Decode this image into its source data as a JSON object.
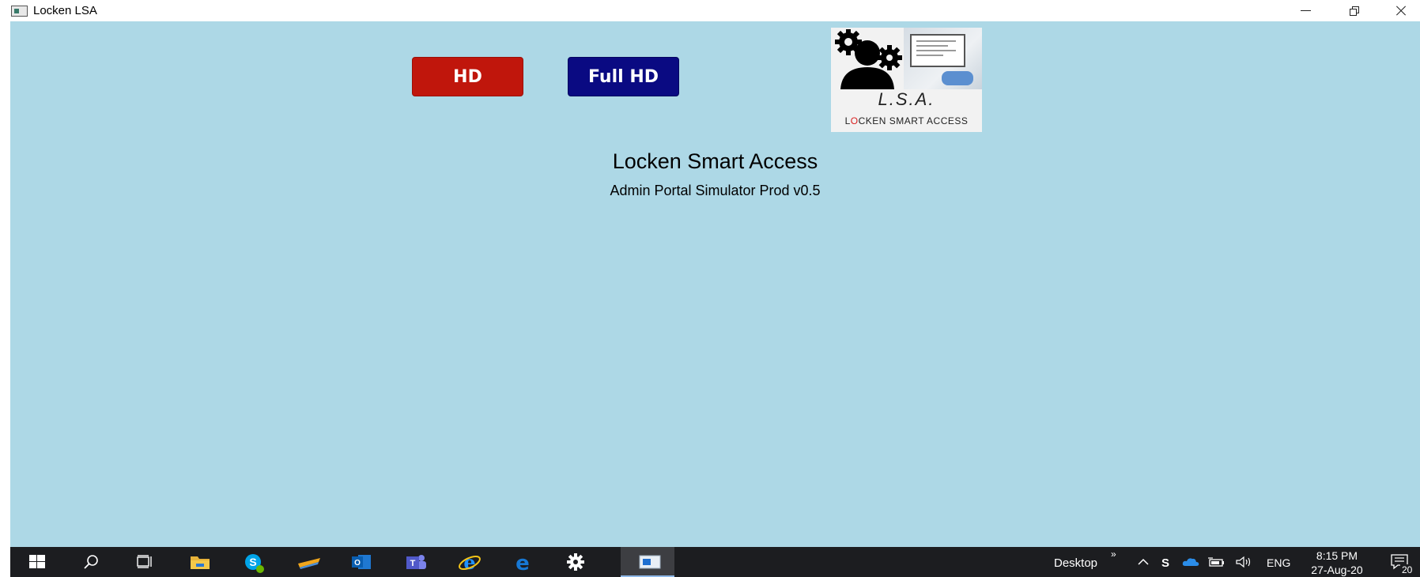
{
  "window": {
    "title": "Locken LSA"
  },
  "buttons": {
    "hd_label": "HD",
    "fullhd_label": "Full HD"
  },
  "logo": {
    "abbrev": "L.S.A.",
    "sub_first": "L",
    "sub_o": "O",
    "sub_rest": "CKEN SMART ACCESS"
  },
  "main": {
    "title": "Locken Smart Access",
    "subtitle": "Admin Portal Simulator Prod v0.5"
  },
  "taskbar": {
    "items": [
      {
        "name": "start-icon"
      },
      {
        "name": "search-icon"
      },
      {
        "name": "task-view-icon"
      },
      {
        "name": "file-explorer-icon"
      },
      {
        "name": "skype-icon"
      },
      {
        "name": "app-icon"
      },
      {
        "name": "outlook-icon"
      },
      {
        "name": "teams-icon"
      },
      {
        "name": "internet-explorer-icon"
      },
      {
        "name": "edge-icon"
      },
      {
        "name": "settings-icon"
      },
      {
        "name": "locken-lsa-taskbar-icon"
      }
    ],
    "desktop_label": "Desktop",
    "chevron": "»",
    "language": "ENG",
    "time": "8:15 PM",
    "date": "27-Aug-20",
    "notification_count": "20"
  },
  "colors": {
    "background": "#add8e6",
    "hd_button": "#c0160c",
    "fullhd_button": "#0a0a82",
    "taskbar": "#1c1d20"
  }
}
